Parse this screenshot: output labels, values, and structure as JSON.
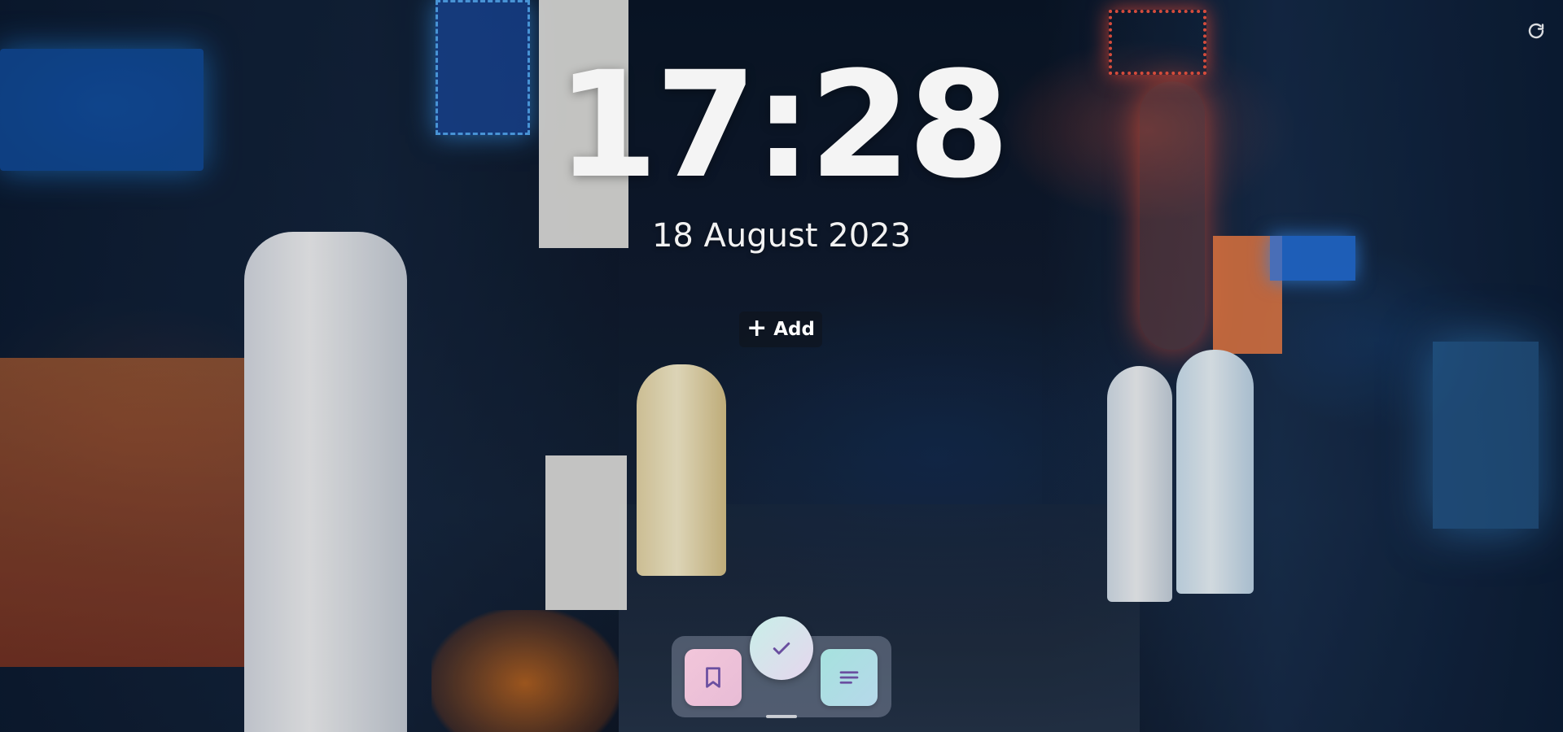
{
  "background": {
    "accent_blue": "#2e8fff",
    "accent_orange": "#ff6a3c"
  },
  "toolbar": {
    "reload_icon": "reload-icon"
  },
  "clock": {
    "time": "17:28",
    "date": "18 August 2023"
  },
  "add": {
    "label": "Add",
    "icon": "plus-icon"
  },
  "dock": {
    "bookmark_icon": "bookmark-icon",
    "check_icon": "check-icon",
    "notes_icon": "notes-icon",
    "bookmark_color": "#f0c4d8",
    "check_color": "#cdeee8",
    "notes_color": "#a8e0de",
    "icon_color": "#6a4fa0"
  }
}
